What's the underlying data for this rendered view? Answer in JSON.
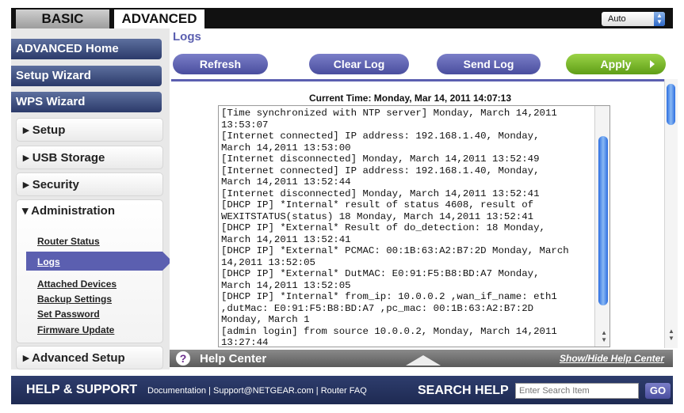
{
  "tabs": {
    "basic": "BASIC",
    "advanced": "ADVANCED"
  },
  "header": {
    "mode_select": "Auto"
  },
  "sidebar": {
    "advanced_home": "ADVANCED Home",
    "setup_wizard": "Setup Wizard",
    "wps_wizard": "WPS Wizard",
    "setup": "▸ Setup",
    "usb_storage": "▸ USB Storage",
    "security": "▸ Security",
    "administration": "▾ Administration",
    "admin_items": [
      "Router Status",
      "Logs",
      "Attached Devices",
      "Backup Settings",
      "Set Password",
      "Firmware Update"
    ],
    "advanced_setup": "▸ Advanced Setup"
  },
  "main": {
    "title": "Logs",
    "buttons": {
      "refresh": "Refresh",
      "clear_log": "Clear Log",
      "send_log": "Send Log",
      "apply": "Apply"
    },
    "current_time": "Current Time: Monday, Mar 14, 2011 14:07:13",
    "log_text": "[Time synchronized with NTP server] Monday, March 14,2011\n13:53:07\n[Internet connected] IP address: 192.168.1.40, Monday,\nMarch 14,2011 13:53:00\n[Internet disconnected] Monday, March 14,2011 13:52:49\n[Internet connected] IP address: 192.168.1.40, Monday,\nMarch 14,2011 13:52:44\n[Internet disconnected] Monday, March 14,2011 13:52:41\n[DHCP IP] *Internal* result of status 4608, result of\nWEXITSTATUS(status) 18 Monday, March 14,2011 13:52:41\n[DHCP IP] *External* Result of do_detection: 18 Monday,\nMarch 14,2011 13:52:41\n[DHCP IP] *External* PCMAC: 00:1B:63:A2:B7:2D Monday, March\n14,2011 13:52:05\n[DHCP IP] *External* DutMAC: E0:91:F5:B8:BD:A7 Monday,\nMarch 14,2011 13:52:05\n[DHCP IP] *Internal* from_ip: 10.0.0.2 ,wan_if_name: eth1\n,dutMac: E0:91:F5:B8:BD:A7 ,pc_mac: 00:1B:63:A2:B7:2D\nMonday, March 1\n[admin login] from source 10.0.0.2, Monday, March 14,2011\n13:27:44"
  },
  "help_center": {
    "label": "Help Center",
    "toggle": "Show/Hide Help Center",
    "icon": "question-icon"
  },
  "footer": {
    "help_support": "HELP & SUPPORT",
    "links": [
      "Documentation",
      "Support@NETGEAR.com",
      "Router FAQ"
    ],
    "separator": "|",
    "search_help": "SEARCH HELP",
    "search_placeholder": "Enter Search Item",
    "go": "GO"
  },
  "colors": {
    "accent": "#5b5fb0",
    "apply": "#6ab02a",
    "nav": "#2b3a6a",
    "footer": "#1e2a52"
  }
}
